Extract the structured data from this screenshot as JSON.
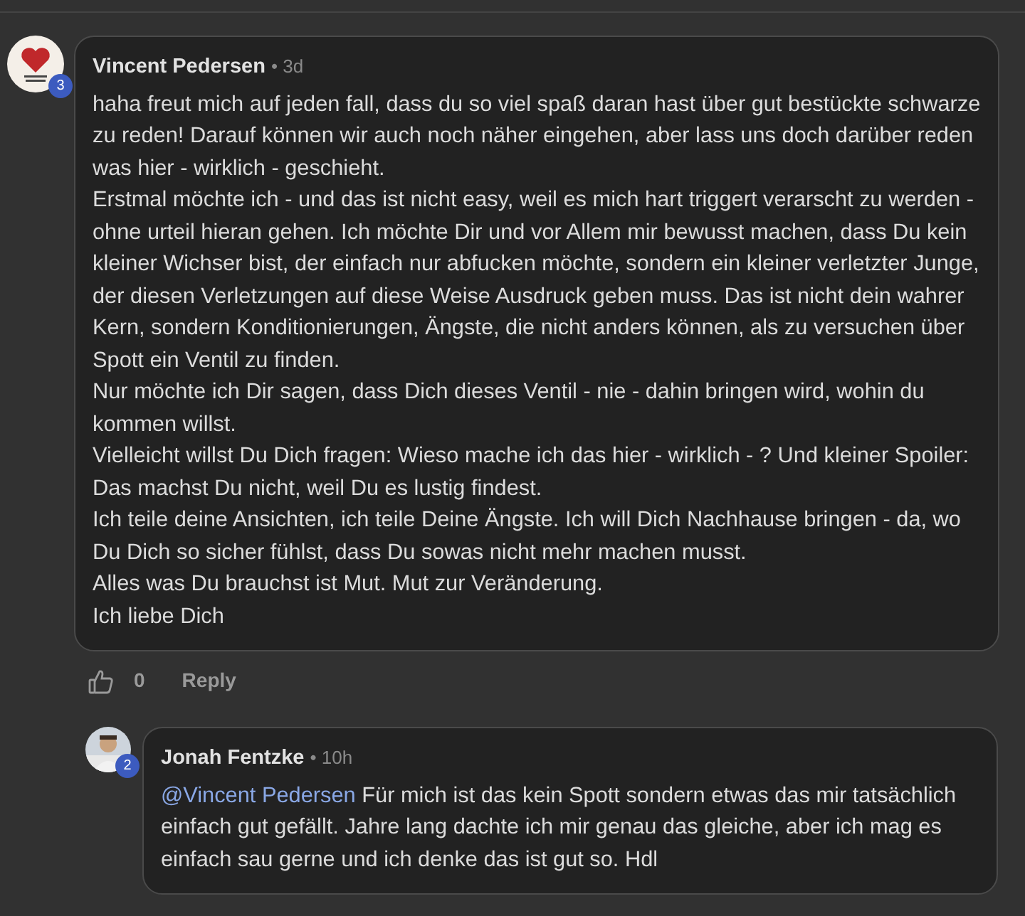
{
  "comments": [
    {
      "kind": "comment",
      "author": "Vincent Pedersen",
      "time": "• 3d",
      "badge": "3",
      "paragraphs": [
        "haha freut mich auf jeden fall, dass du so viel spaß daran hast über gut bestückte schwarze zu reden! Darauf können wir auch noch näher eingehen, aber lass uns doch darüber reden was hier - wirklich - geschieht.",
        "Erstmal möchte ich - und das ist nicht easy, weil es mich hart triggert verarscht zu werden - ohne urteil hieran gehen. Ich möchte Dir und vor Allem mir bewusst machen, dass Du kein kleiner Wichser bist, der einfach nur abfucken möchte, sondern ein kleiner verletzter Junge, der diesen Verletzungen auf diese Weise Ausdruck geben muss. Das ist nicht dein wahrer Kern, sondern Konditionierungen, Ängste, die nicht anders können, als zu versuchen über Spott ein Ventil zu finden.",
        "Nur möchte ich Dir sagen, dass Dich dieses Ventil - nie - dahin bringen wird, wohin du kommen willst.",
        "Vielleicht willst Du Dich fragen: Wieso mache ich das hier - wirklich - ? Und kleiner Spoiler: Das machst Du nicht, weil Du es lustig findest.",
        "Ich teile deine Ansichten, ich teile Deine Ängste. Ich will Dich Nachhause bringen - da, wo Du Dich so sicher fühlst, dass Du sowas nicht mehr machen musst.",
        "Alles was Du brauchst ist Mut. Mut zur Veränderung.",
        "Ich liebe Dich"
      ],
      "likes": "0",
      "reply": "Reply"
    },
    {
      "kind": "reply",
      "author": "Jonah Fentzke",
      "time": "• 10h",
      "badge": "2",
      "mention": "@Vincent Pedersen",
      "paragraphs": [
        "Für mich ist das kein Spott sondern etwas das mir tatsächlich einfach gut gefällt. Jahre lang dachte ich mir genau das gleiche, aber ich mag es einfach sau gerne und ich denke das ist gut so. Hdl"
      ]
    }
  ]
}
